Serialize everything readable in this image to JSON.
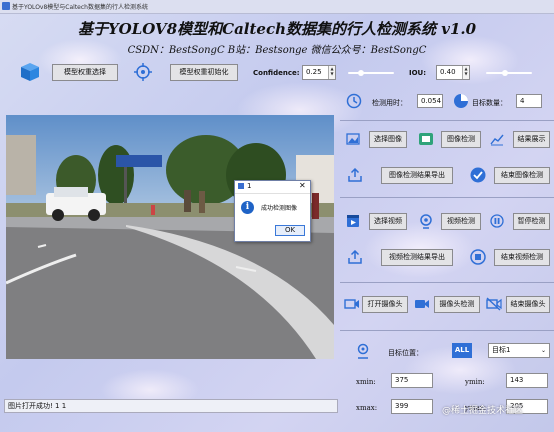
{
  "window": {
    "title": "基于YOLOv8模型与Caltech数据集的行人检测系统"
  },
  "header": {
    "title": "基于YOLOV8模型和Caltech数据集的行人检测系统 v1.0",
    "subtitle": "CSDN：BestSongC    B站：Bestsonge    微信公众号：BestSongC"
  },
  "toolbar": {
    "model_select": "模型权重选择",
    "model_init": "模型权重初始化",
    "confidence_label": "Confidence:",
    "confidence_value": "0.25",
    "confidence_level": 0.25,
    "iou_label": "IOU:",
    "iou_value": "0.40",
    "iou_level": 0.4
  },
  "stats": {
    "time_label": "检测用时：",
    "time_value": "0.054",
    "count_label": "目标数量：",
    "count_value": "4"
  },
  "image_panel": {
    "select": "选择图像",
    "detect": "图像检测",
    "show": "结果展示",
    "export": "图像检测结果导出",
    "finish": "结束图像检测"
  },
  "video_panel": {
    "select": "选择视频",
    "detect": "视频检测",
    "pause": "暂停检测",
    "export": "视频检测结果导出",
    "finish": "结束视频检测"
  },
  "camera_panel": {
    "open": "打开摄像头",
    "detect": "摄像头检测",
    "close": "结束摄像头"
  },
  "target_panel": {
    "position_label": "目标位置：",
    "badge": "ALL",
    "selected": "目标1",
    "xmin_label": "xmin:",
    "xmin": "375",
    "ymin_label": "ymin:",
    "ymin": "143",
    "xmax_label": "xmax:",
    "xmax": "399",
    "ymax_label": "ymax:",
    "ymax": "205"
  },
  "status": {
    "text": "图片打开成功! 1 1"
  },
  "dialog": {
    "title": "1",
    "message": "成功检测图像",
    "ok": "OK",
    "info_glyph": "i",
    "close_glyph": "✕"
  },
  "watermark": "@稀土掘金技术社区",
  "colors": {
    "accent": "#2f6fd6",
    "slider": "#ffffff"
  }
}
